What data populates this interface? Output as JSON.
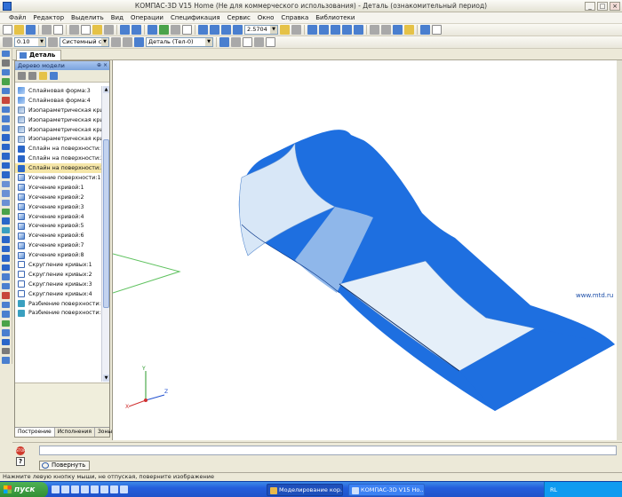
{
  "window": {
    "title": "КОМПАС-3D V15 Home (Не для коммерческого использования) - Деталь (ознакомительный период)"
  },
  "menu": [
    "Файл",
    "Редактор",
    "Выделить",
    "Вид",
    "Операции",
    "Спецификация",
    "Сервис",
    "Окно",
    "Справка",
    "Библиотеки"
  ],
  "toolbar": {
    "zoom_value": "2.5704",
    "line_width": "0.10",
    "layer": "Системный слой (0)",
    "part_combo": "Деталь (Тел-0)"
  },
  "doc_tab": {
    "label": "Деталь"
  },
  "tree_panel": {
    "title": "Дерево модели",
    "items": [
      {
        "label": "Сплайновая форма:3",
        "icon": "spline-form-icon"
      },
      {
        "label": "Сплайновая форма:4",
        "icon": "spline-form-icon"
      },
      {
        "label": "Изопараметрическая кривая",
        "icon": "isoparametric-curve-icon"
      },
      {
        "label": "Изопараметрическая кривая",
        "icon": "isoparametric-curve-icon"
      },
      {
        "label": "Изопараметрическая кривая",
        "icon": "isoparametric-curve-icon"
      },
      {
        "label": "Изопараметрическая кривая",
        "icon": "isoparametric-curve-icon"
      },
      {
        "label": "Сплайн на поверхности:1",
        "icon": "surface-spline-icon"
      },
      {
        "label": "Сплайн на поверхности:2",
        "icon": "surface-spline-icon"
      },
      {
        "label": "Сплайн на поверхности:3",
        "icon": "surface-spline-icon",
        "selected": true
      },
      {
        "label": "Усечение поверхности:1",
        "icon": "surface-trim-icon"
      },
      {
        "label": "Усечение кривой:1",
        "icon": "curve-trim-icon"
      },
      {
        "label": "Усечение кривой:2",
        "icon": "curve-trim-icon"
      },
      {
        "label": "Усечение кривой:3",
        "icon": "curve-trim-icon"
      },
      {
        "label": "Усечение кривой:4",
        "icon": "curve-trim-icon"
      },
      {
        "label": "Усечение кривой:5",
        "icon": "curve-trim-icon"
      },
      {
        "label": "Усечение кривой:6",
        "icon": "curve-trim-icon"
      },
      {
        "label": "Усечение кривой:7",
        "icon": "curve-trim-icon"
      },
      {
        "label": "Усечение кривой:8",
        "icon": "curve-trim-icon"
      },
      {
        "label": "Скругление кривых:1",
        "icon": "curve-fillet-icon"
      },
      {
        "label": "Скругление кривых:2",
        "icon": "curve-fillet-icon"
      },
      {
        "label": "Скругление кривых:3",
        "icon": "curve-fillet-icon"
      },
      {
        "label": "Скругление кривых:4",
        "icon": "curve-fillet-icon"
      },
      {
        "label": "Разбиение поверхности:1",
        "icon": "surface-split-icon"
      },
      {
        "label": "Разбиение поверхности:2",
        "icon": "surface-split-icon"
      }
    ],
    "tabs": [
      "Построение",
      "Исполнения",
      "Зоны"
    ]
  },
  "command": {
    "rotate_label": "Повернуть"
  },
  "status": {
    "text": "Нажмите левую кнопку мыши, не отпуская, поверните изображение"
  },
  "taskbar": {
    "start_label": "пуск",
    "tasks": [
      "Моделирование кор...",
      "КОМПАС-3D V15 Ho..."
    ],
    "tray_lang": "RL",
    "watermark": "www.mtd.ru"
  },
  "colors": {
    "surface": "#1f6fe0",
    "surface_light": "#d7e7f7",
    "axis_x": "#d03030",
    "axis_y": "#30a030",
    "axis_z": "#2050d0"
  }
}
